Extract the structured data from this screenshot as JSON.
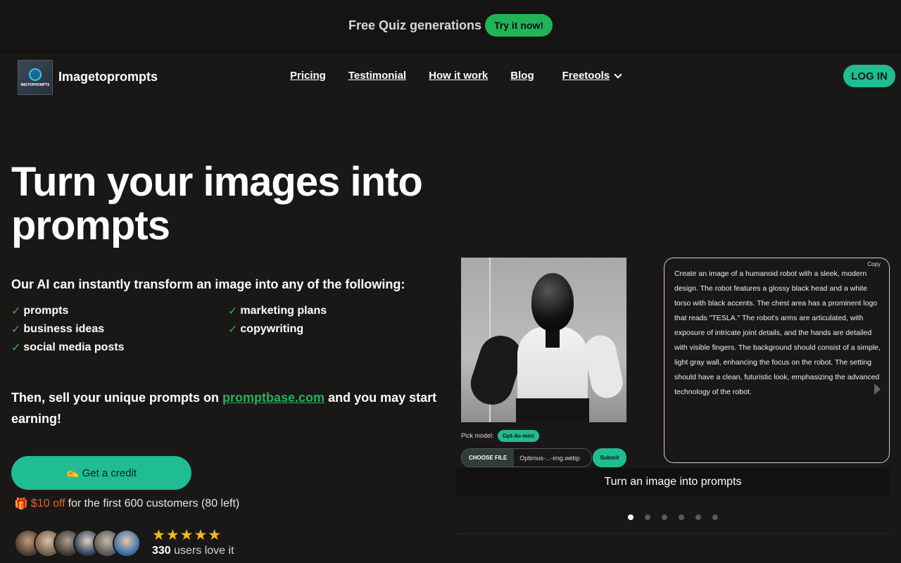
{
  "banner": {
    "text": "Free Quiz generations",
    "cta": "Try it now!"
  },
  "header": {
    "brand": "Imagetoprompts",
    "logo_text": "IMGTOPROMPTS",
    "nav": [
      "Pricing",
      "Testimonial",
      "How it work",
      "Blog",
      "Freetools"
    ],
    "login": "LOG IN"
  },
  "hero": {
    "title": "Turn your images into prompts",
    "subtitle": "Our AI can instantly transform an image into any of the following:",
    "features": [
      "prompts",
      "marketing plans",
      "business ideas",
      "copywriting",
      "social media posts"
    ],
    "sell_pre": "Then, sell your unique prompts on",
    "sell_link": "promptbase.com",
    "sell_post": "and you may start earning!",
    "credit_icon": "✍️",
    "credit_btn": "Get a credit",
    "offer_icon": "🎁",
    "offer_discount": "$10 off",
    "offer_rest": "for the first 600 customers (80 left)",
    "stars": "★★★★★",
    "users_count": "330",
    "users_text": "users love it"
  },
  "showcase": {
    "pick_model_label": "Pick model:",
    "model": "Gpt-4o-mini",
    "choose_file": "CHOOSE FILE",
    "file_name": "Optimus-...-img.webp",
    "submit": "Submit",
    "copy": "Copy",
    "output": "Create an image of a humanoid robot with a sleek, modern design. The robot features a glossy black head and a white torso with black accents. The chest area has a prominent logo that reads \"TESLA.\" The robot's arms are articulated, with exposure of intricate joint details, and the hands are detailed with visible fingers. The background should consist of a simple, light gray wall, enhancing the focus on the robot. The setting should have a clean, futuristic look, emphasizing the advanced technology of the robot.",
    "caption": "Turn an image into prompts",
    "dots": 6,
    "active_dot": 0
  },
  "colors": {
    "accent": "#1fbd91",
    "green": "#21b35a",
    "discount": "#e8622c",
    "star": "#f5b91e",
    "bg": "#1a1717"
  }
}
